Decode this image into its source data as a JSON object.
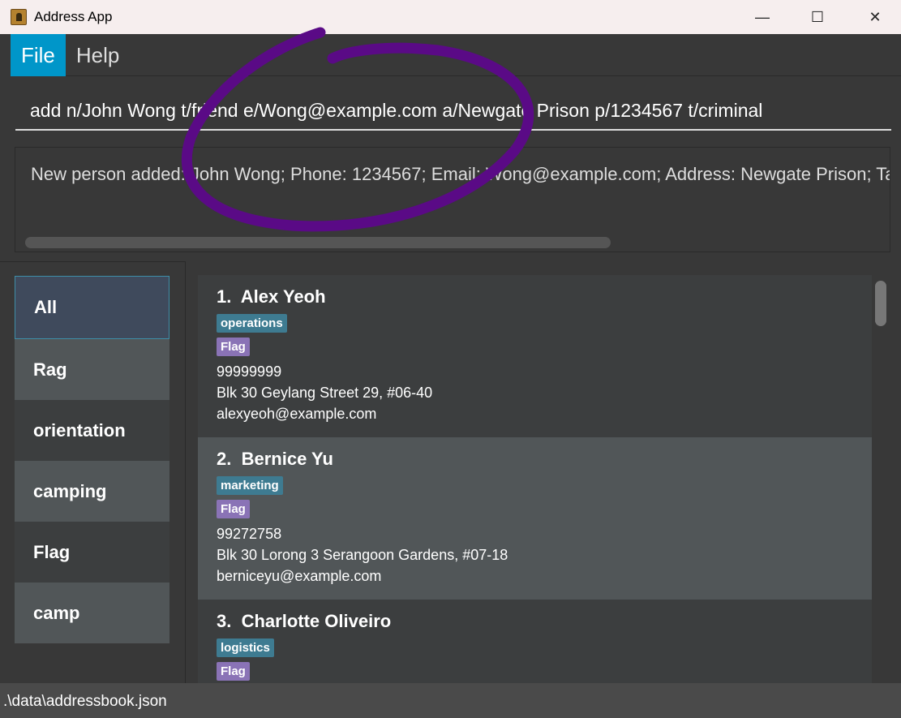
{
  "window": {
    "title": "Address App"
  },
  "menu": [
    "File",
    "Help"
  ],
  "command": {
    "value": "add n/John Wong t/friend e/Wong@example.com a/Newgate Prison p/1234567 t/criminal"
  },
  "result": {
    "text": "New person added: John Wong; Phone: 1234567; Email: Wong@example.com; Address: Newgate Prison; Tags: [friend][criminal]"
  },
  "tags": [
    "All",
    "Rag",
    "orientation",
    "camping",
    "Flag",
    "camp"
  ],
  "persons": [
    {
      "index": "1.",
      "name": "Alex Yeoh",
      "tags": [
        "operations",
        "Flag"
      ],
      "phone": "99999999",
      "address": "Blk 30 Geylang Street 29, #06-40",
      "email": "alexyeoh@example.com"
    },
    {
      "index": "2.",
      "name": "Bernice Yu",
      "tags": [
        "marketing",
        "Flag"
      ],
      "phone": "99272758",
      "address": "Blk 30 Lorong 3 Serangoon Gardens, #07-18",
      "email": "berniceyu@example.com"
    },
    {
      "index": "3.",
      "name": "Charlotte Oliveiro",
      "tags": [
        "logistics",
        "Flag"
      ],
      "phone": "",
      "address": "",
      "email": ""
    }
  ],
  "status": {
    "path": ".\\data\\addressbook.json"
  },
  "colors": {
    "accent": "#0096c9",
    "tag_primary": "#3e7b91",
    "tag_flag": "#8a73b6",
    "annotation": "#5a0a86"
  }
}
